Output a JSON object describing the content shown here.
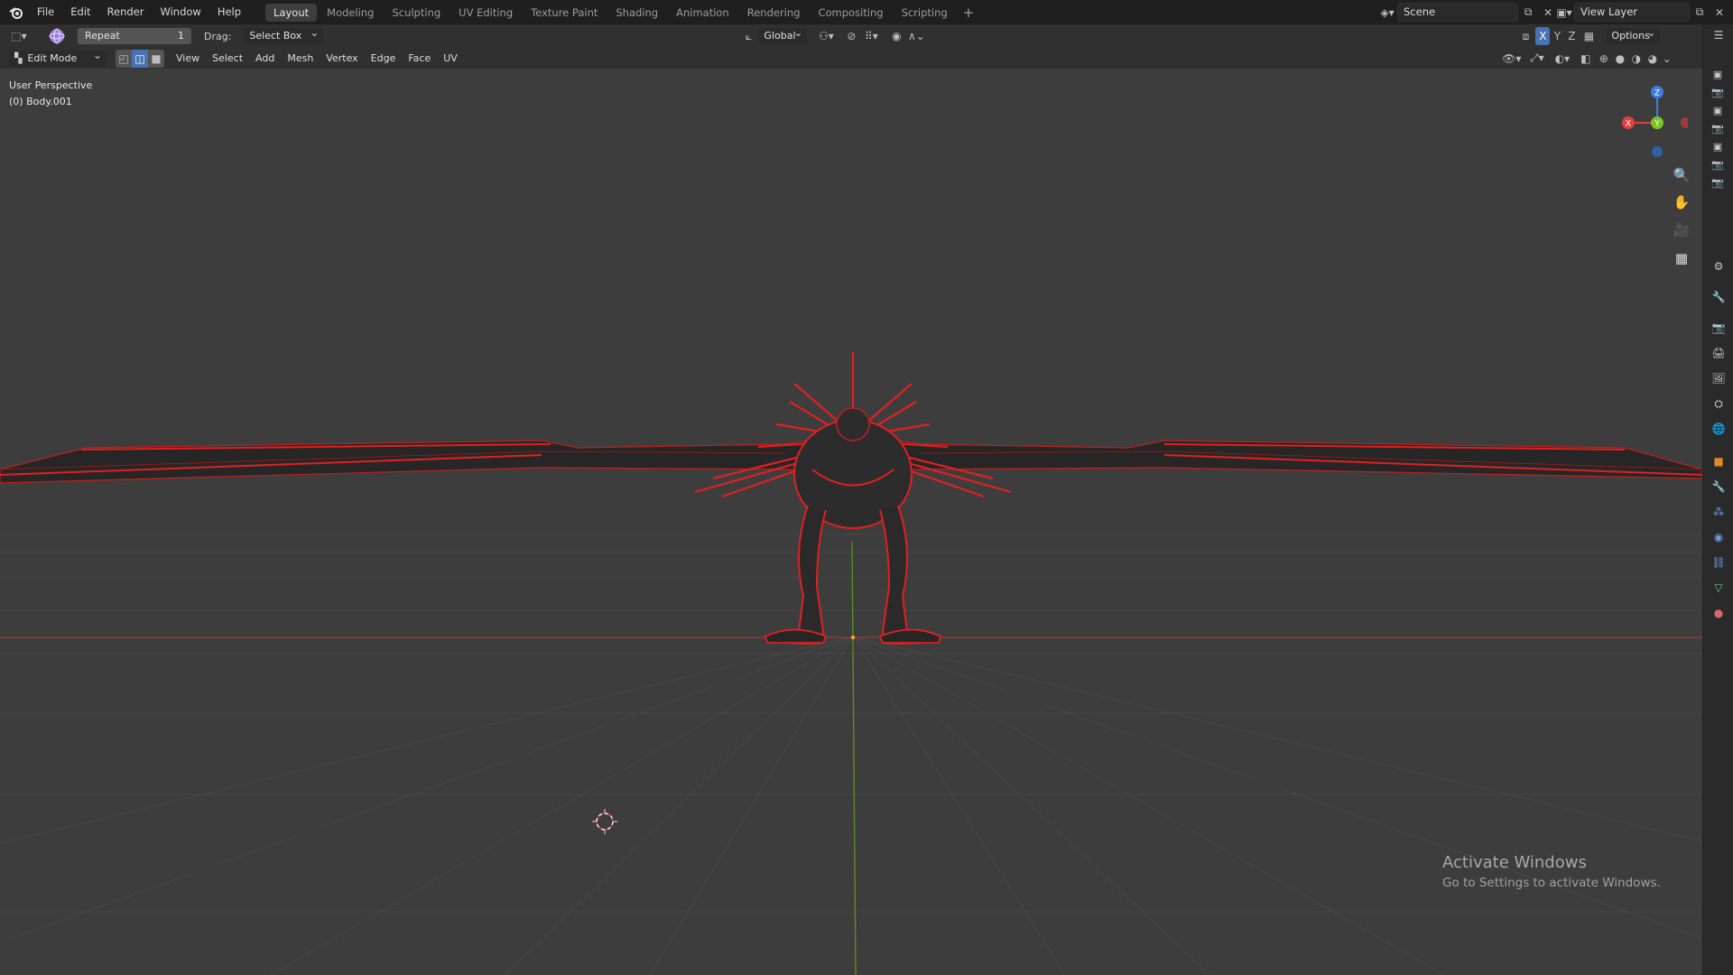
{
  "topbar": {
    "menus": [
      "File",
      "Edit",
      "Render",
      "Window",
      "Help"
    ],
    "workspaces": [
      "Layout",
      "Modeling",
      "Sculpting",
      "UV Editing",
      "Texture Paint",
      "Shading",
      "Animation",
      "Rendering",
      "Compositing",
      "Scripting"
    ],
    "active_workspace": "Layout",
    "add_tab": "+",
    "scene": "Scene",
    "view_layer": "View Layer"
  },
  "header1": {
    "repeat_label": "Repeat",
    "repeat_value": "1",
    "drag_label": "Drag:",
    "drag_value": "Select Box",
    "orientation": "Global",
    "options": "Options"
  },
  "header2": {
    "mode": "Edit Mode",
    "menus": [
      "View",
      "Select",
      "Add",
      "Mesh",
      "Vertex",
      "Edge",
      "Face",
      "UV"
    ],
    "axes": [
      "X",
      "Y",
      "Z"
    ]
  },
  "viewport": {
    "view_name": "User Perspective",
    "object_name": "(0) Body.001",
    "gizmo": {
      "x": "X",
      "y": "Y",
      "z": "Z"
    }
  },
  "watermark": {
    "title": "Activate Windows",
    "subtitle": "Go to Settings to activate Windows."
  },
  "colors": {
    "wire_red": "#e02020",
    "axis_x": "#e04040",
    "axis_y": "#7bc425",
    "axis_z": "#3b7fdb"
  }
}
